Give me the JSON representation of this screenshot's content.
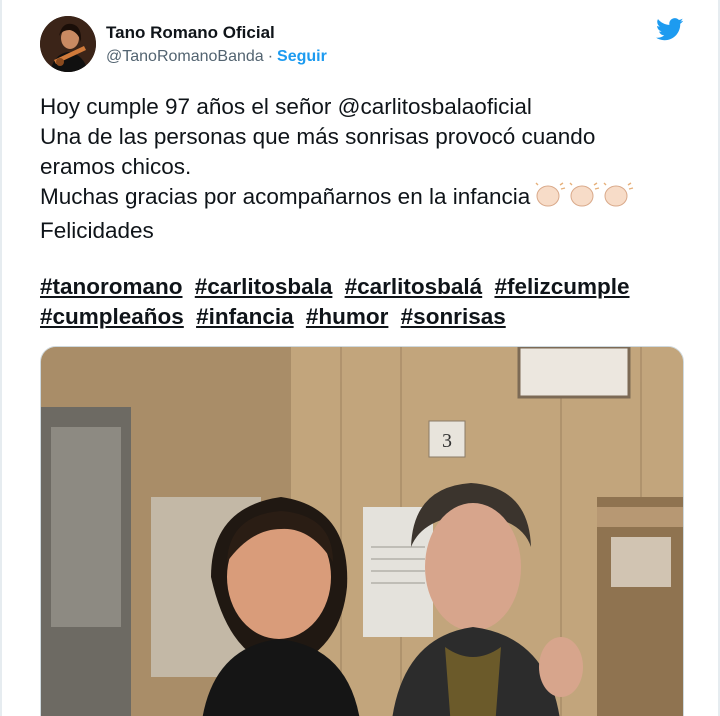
{
  "author": {
    "name": "Tano Romano Oficial",
    "handle": "@TanoRomanoBanda",
    "separator": "·",
    "follow_label": "Seguir"
  },
  "icons": {
    "avatar": "avatar",
    "brand": "twitter-bird-icon",
    "emoji": "clapping-hands-icon"
  },
  "tweet": {
    "lines": [
      "Hoy cumple 97 años el señor @carlitosbalaoficial",
      "Una de las personas que más sonrisas provocó cuando",
      "eramos chicos.",
      "Muchas gracias por acompañarnos en la infancia",
      "Felicidades"
    ],
    "hashtags": [
      "#tanoromano",
      "#carlitosbala",
      "#carlitosbalá",
      "#felizcumple",
      "#cumpleaños",
      "#infancia",
      "#humor",
      "#sonrisas"
    ]
  },
  "media": {
    "sign_number": "3"
  },
  "colors": {
    "brand_blue": "#1d9bf0",
    "text": "#0f1419",
    "secondary": "#536471",
    "border": "#cfd9de"
  }
}
